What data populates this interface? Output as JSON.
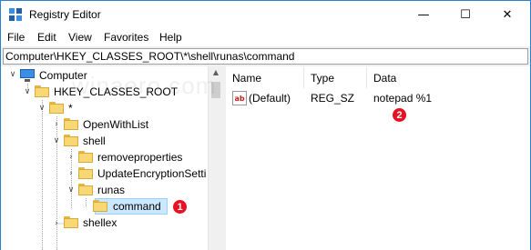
{
  "window": {
    "title": "Registry Editor",
    "minimize_glyph": "—",
    "maximize_glyph": "☐",
    "close_glyph": "✕"
  },
  "menu": [
    "File",
    "Edit",
    "View",
    "Favorites",
    "Help"
  ],
  "address": "Computer\\HKEY_CLASSES_ROOT\\*\\shell\\runas\\command",
  "watermark": "winaero.com",
  "tree": {
    "scroll_up_glyph": "▲",
    "nodes": [
      {
        "label": "Computer",
        "chevron": "∨"
      },
      {
        "label": "HKEY_CLASSES_ROOT",
        "chevron": "∨"
      },
      {
        "label": "*",
        "chevron": "∨"
      },
      {
        "label": "OpenWithList",
        "chevron": "›"
      },
      {
        "label": "shell",
        "chevron": "∨"
      },
      {
        "label": "removeproperties",
        "chevron": "›"
      },
      {
        "label": "UpdateEncryptionSetti",
        "chevron": "›"
      },
      {
        "label": "runas",
        "chevron": "∨"
      },
      {
        "label": "command",
        "chevron": ""
      },
      {
        "label": "shellex",
        "chevron": "›"
      }
    ],
    "selected": "command"
  },
  "list": {
    "columns": {
      "name": "Name",
      "type": "Type",
      "data": "Data"
    },
    "rows": [
      {
        "icon": "ab",
        "name": "(Default)",
        "type": "REG_SZ",
        "data": "notepad %1"
      }
    ]
  },
  "badges": {
    "one": "1",
    "two": "2"
  },
  "colors": {
    "badge": "#e81123",
    "selection": "#cce8ff",
    "folder": "#f8d775",
    "frame": "#2b7fd1"
  }
}
